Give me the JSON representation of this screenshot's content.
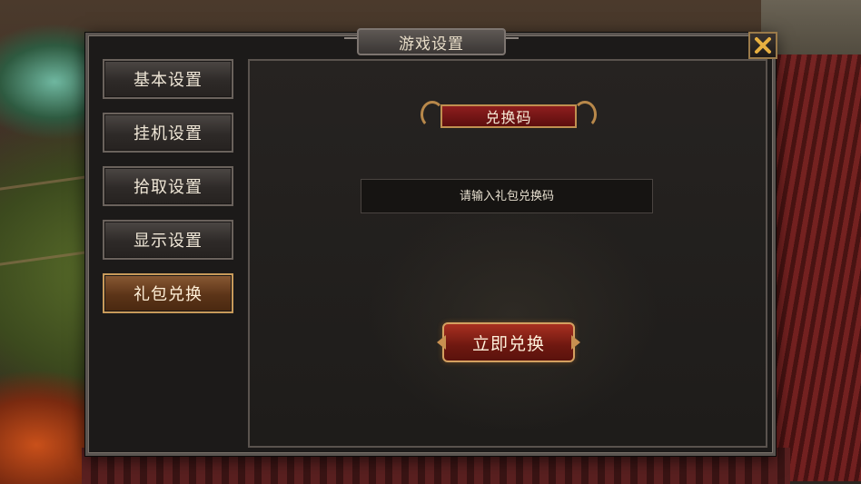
{
  "window": {
    "title": "游戏设置"
  },
  "sidebar": {
    "items": [
      {
        "label": "基本设置",
        "active": false
      },
      {
        "label": "挂机设置",
        "active": false
      },
      {
        "label": "拾取设置",
        "active": false
      },
      {
        "label": "显示设置",
        "active": false
      },
      {
        "label": "礼包兑换",
        "active": true
      }
    ]
  },
  "redeem_panel": {
    "section_title": "兑换码",
    "code_placeholder": "请输入礼包兑换码",
    "code_value": "",
    "submit_label": "立即兑换"
  },
  "icons": {
    "close": "close-icon"
  },
  "colors": {
    "accent_gold": "#c89a5a",
    "banner_red": "#8e1e1e",
    "close_x": "#e8b040"
  }
}
